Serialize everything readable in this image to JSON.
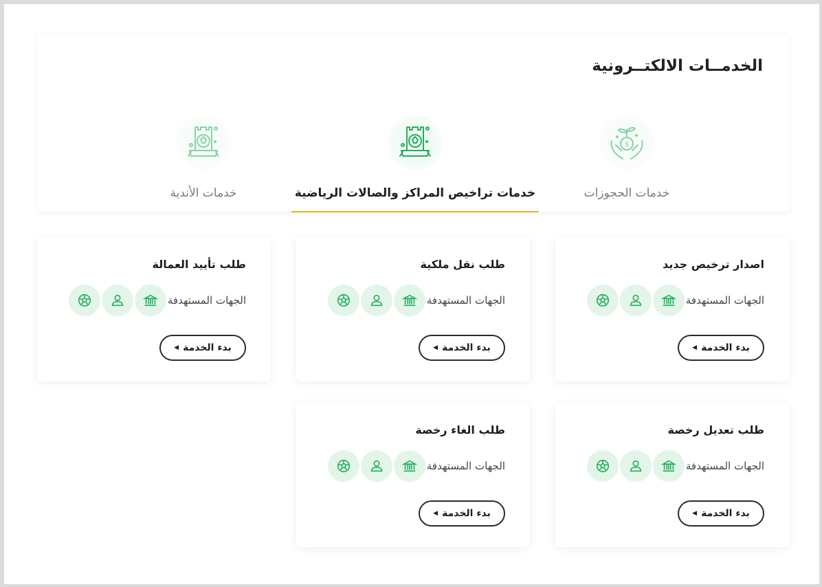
{
  "section": {
    "title": "الخدمــات الالكتــرونية"
  },
  "tabs": [
    {
      "label": "خدمات الحجوزات",
      "icon": "hands-money-icon",
      "active": false
    },
    {
      "label": "خدمات تراخيص المراكز والصالات الرياضية",
      "icon": "sports-club-badge-icon",
      "active": true
    },
    {
      "label": "خدمات الأندية",
      "icon": "sports-club-badge-icon",
      "active": false
    }
  ],
  "cards": [
    {
      "title": "اصدار ترخيص جديد",
      "beneficiaries_label": "الجهات المستهدفة",
      "button_label": "بدء الخدمة"
    },
    {
      "title": "طلب نقل ملكية",
      "beneficiaries_label": "الجهات المستهدفة",
      "button_label": "بدء الخدمة"
    },
    {
      "title": "طلب تأييد العمالة",
      "beneficiaries_label": "الجهات المستهدفة",
      "button_label": "بدء الخدمة"
    },
    {
      "title": "طلب تعديل رخصة",
      "beneficiaries_label": "الجهات المستهدفة",
      "button_label": "بدء الخدمة"
    },
    {
      "title": "طلب الغاء رخصة",
      "beneficiaries_label": "الجهات المستهدفة",
      "button_label": "بدء الخدمة"
    }
  ],
  "beneficiary_icons": [
    "government-building-icon",
    "person-icon",
    "football-icon"
  ],
  "colors": {
    "accent_green": "#27ae60",
    "badge_bg": "#e3f5e8",
    "tab_underline": "#e6b422"
  }
}
